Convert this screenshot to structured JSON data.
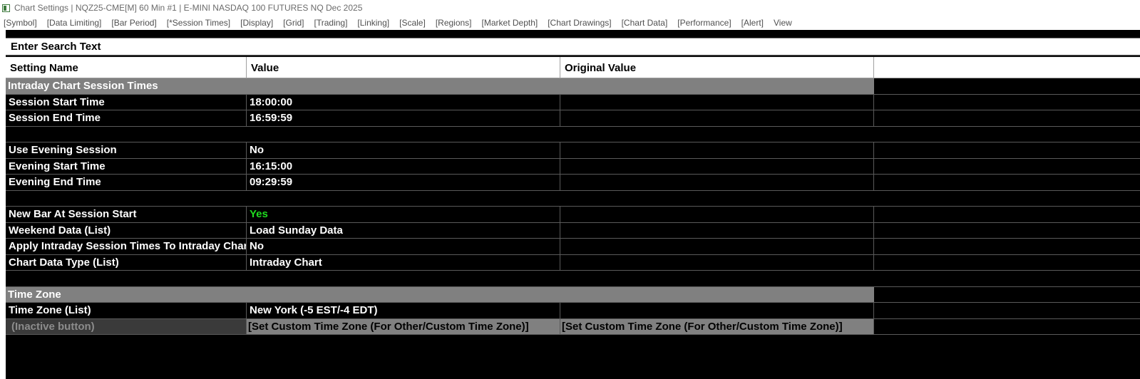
{
  "window": {
    "title": "Chart Settings | NQZ25-CME[M]  60 Min  #1 | E-MINI NASDAQ 100 FUTURES NQ Dec 2025"
  },
  "menu": [
    "[Symbol]",
    "[Data Limiting]",
    "[Bar Period]",
    "[*Session Times]",
    "[Display]",
    "[Grid]",
    "[Trading]",
    "[Linking]",
    "[Scale]",
    "[Regions]",
    "[Market Depth]",
    "[Chart Drawings]",
    "[Chart Data]",
    "[Performance]",
    "[Alert]",
    "View"
  ],
  "search": {
    "text": "Enter Search Text"
  },
  "columns": {
    "name": "Setting Name",
    "value": "Value",
    "original": "Original Value"
  },
  "rows": [
    {
      "type": "section",
      "title": "Intraday Chart Session Times"
    },
    {
      "type": "setting",
      "name": "Session Start Time",
      "value": "18:00:00",
      "original": ""
    },
    {
      "type": "setting",
      "name": "Session End Time",
      "value": "16:59:59",
      "original": ""
    },
    {
      "type": "blank"
    },
    {
      "type": "setting",
      "name": "Use Evening Session",
      "value": "No",
      "original": ""
    },
    {
      "type": "setting",
      "name": "Evening Start Time",
      "value": "16:15:00",
      "original": ""
    },
    {
      "type": "setting",
      "name": "Evening End Time",
      "value": "09:29:59",
      "original": ""
    },
    {
      "type": "blank"
    },
    {
      "type": "setting",
      "name": "New Bar At Session Start",
      "value": "Yes",
      "original": "",
      "value_color": "#1fdc1f"
    },
    {
      "type": "setting",
      "name": "Weekend Data (List)",
      "value": "Load Sunday Data",
      "original": ""
    },
    {
      "type": "setting",
      "name": "Apply Intraday Session Times To Intraday Charts",
      "value": "No",
      "original": ""
    },
    {
      "type": "setting",
      "name": "Chart Data Type (List)",
      "value": "Intraday Chart",
      "original": ""
    },
    {
      "type": "blank"
    },
    {
      "type": "section",
      "title": "Time Zone"
    },
    {
      "type": "setting",
      "name": "Time Zone (List)",
      "value": "New York (-5 EST/-4 EDT)",
      "original": ""
    },
    {
      "type": "inactive",
      "name": "(Inactive button)",
      "value": "[Set Custom Time Zone (For Other/Custom Time Zone)]",
      "original": "[Set Custom Time Zone (For Other/Custom Time Zone)]"
    }
  ],
  "colors": {
    "section_bg": "#808080",
    "grid_bg": "#000000",
    "yes_green": "#1fdc1f"
  }
}
